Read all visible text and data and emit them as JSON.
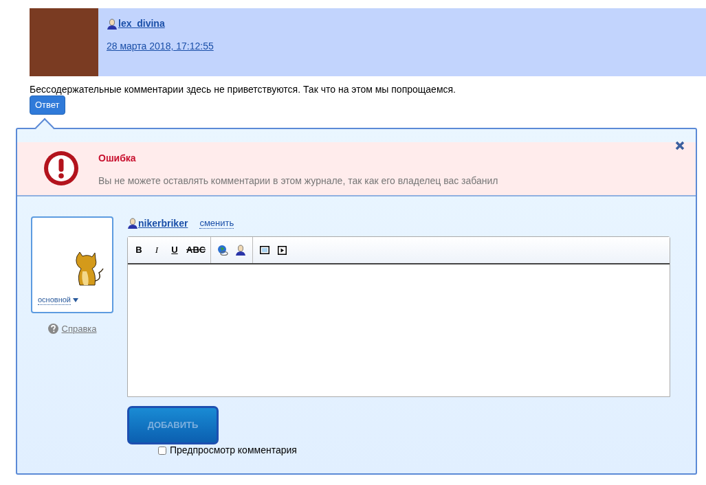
{
  "entry": {
    "author": "lex_divina",
    "date": "28 марта 2018, 17:12:55",
    "text": "Бессодержательные комментарии здесь не приветствуются. Так что на этом мы попрощаемся.",
    "reply": "Ответ"
  },
  "error": {
    "title": "Ошибка",
    "message": "Вы не можете оставлять комментарии в этом журнале, так как его владелец вас забанил"
  },
  "form": {
    "userpic_label": "основной",
    "help": "Справка",
    "user": "nikerbriker",
    "change": "сменить",
    "format_buttons": [
      {
        "kind": "bold",
        "label": "B"
      },
      {
        "kind": "italic",
        "label": "I"
      },
      {
        "kind": "underline",
        "label": "U"
      },
      {
        "kind": "strike",
        "label": "ABC"
      }
    ],
    "submit": {
      "label": "ДОБАВИТЬ",
      "disabled": true
    },
    "preview": {
      "label": "Предпросмотр комментария",
      "checked": false
    }
  }
}
